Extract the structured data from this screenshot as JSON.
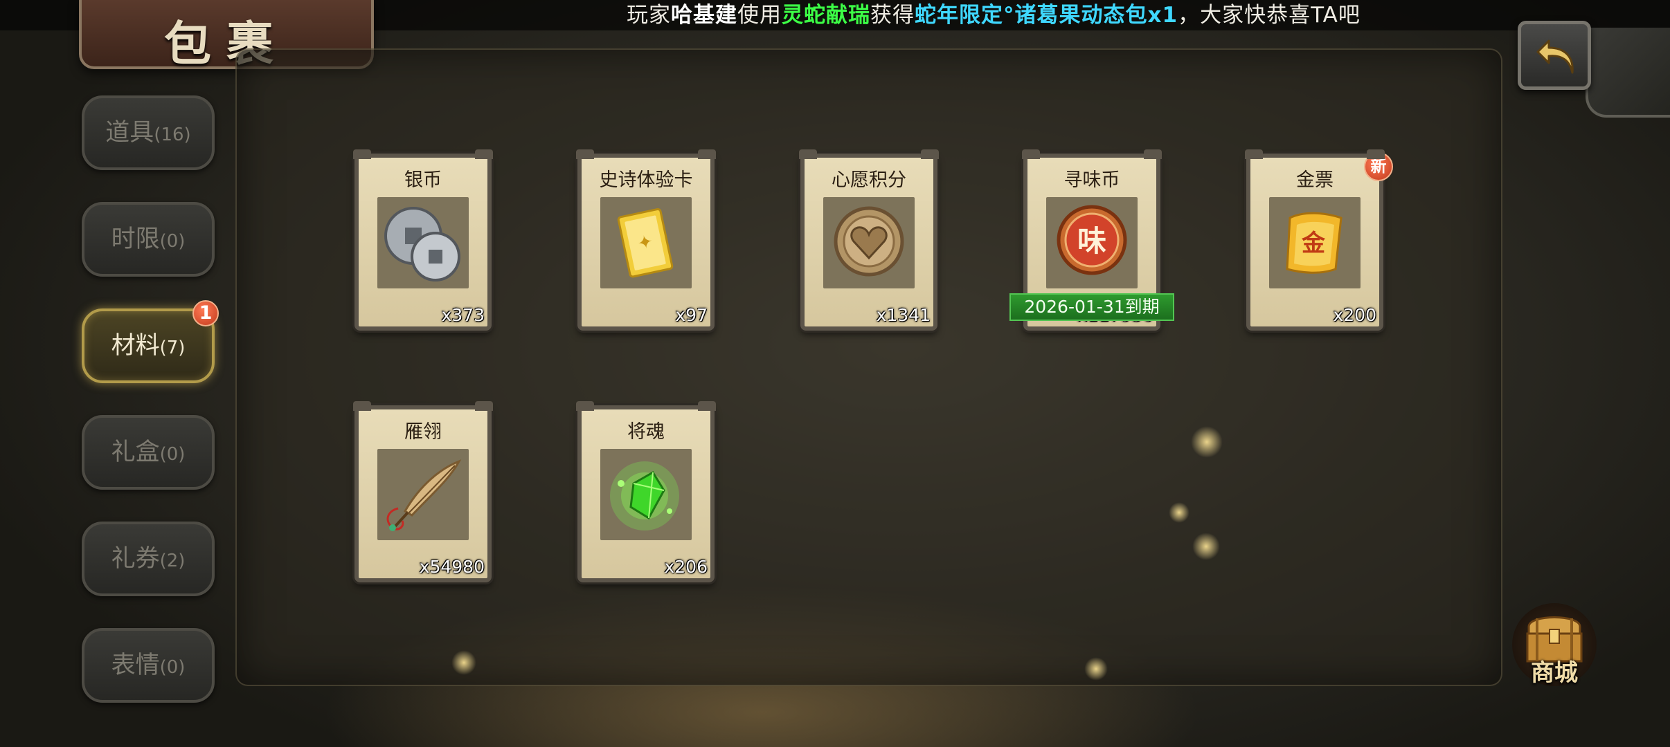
{
  "title": "包裹",
  "announcement": {
    "prefix": "玩家",
    "player": "哈基建",
    "use": "使用",
    "item": "灵蛇献瑞",
    "got": "获得",
    "reward": "蛇年限定°诸葛果动态包x1",
    "suffix": "，大家快恭喜TA吧"
  },
  "tabs": [
    {
      "label": "道具",
      "count": "(16)",
      "active": false
    },
    {
      "label": "时限",
      "count": "(0)",
      "active": false
    },
    {
      "label": "材料",
      "count": "(7)",
      "active": true,
      "badge": "1"
    },
    {
      "label": "礼盒",
      "count": "(0)",
      "active": false
    },
    {
      "label": "礼券",
      "count": "(2)",
      "active": false
    },
    {
      "label": "表情",
      "count": "(0)",
      "active": false
    }
  ],
  "items": [
    {
      "name": "银币",
      "qty": "x373",
      "icon": "silver-coin-icon"
    },
    {
      "name": "史诗体验卡",
      "qty": "x97",
      "icon": "epic-card-icon"
    },
    {
      "name": "心愿积分",
      "qty": "x1341",
      "icon": "wish-points-icon"
    },
    {
      "name": "寻味币",
      "qty": "x117930",
      "icon": "flavor-coin-icon",
      "expiry": "2026-01-31到期"
    },
    {
      "name": "金票",
      "qty": "x200",
      "icon": "gold-ticket-icon",
      "badge": "新"
    },
    {
      "name": "雁翎",
      "qty": "x54980",
      "icon": "feather-icon"
    },
    {
      "name": "将魂",
      "qty": "x206",
      "icon": "general-soul-icon"
    }
  ],
  "shop": {
    "label": "商城",
    "icon": "treasure-chest-icon"
  },
  "colors": {
    "accent": "#b29b4a",
    "player_name": "#ffffff",
    "item_name": "#3cff46",
    "reward_name": "#3fd8ff",
    "expiry_bg": "#1c6f1e"
  }
}
